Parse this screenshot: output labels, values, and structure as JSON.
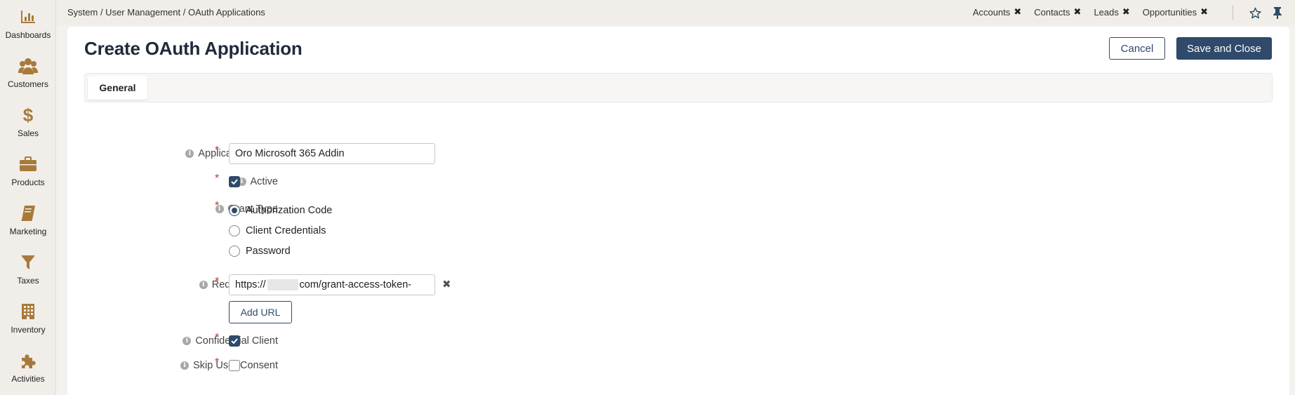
{
  "sidebar": {
    "items": [
      {
        "label": "Dashboards",
        "icon": "bar-chart-icon"
      },
      {
        "label": "Customers",
        "icon": "users-icon"
      },
      {
        "label": "Sales",
        "icon": "dollar-icon"
      },
      {
        "label": "Products",
        "icon": "briefcase-icon"
      },
      {
        "label": "Marketing",
        "icon": "book-icon"
      },
      {
        "label": "Taxes",
        "icon": "filter-icon"
      },
      {
        "label": "Inventory",
        "icon": "building-icon"
      },
      {
        "label": "Activities",
        "icon": "puzzle-icon"
      }
    ],
    "icon_color": "#a77a3b"
  },
  "topbar": {
    "breadcrumb": "System / User Management / OAuth Applications",
    "pinned_tabs": [
      "Accounts",
      "Contacts",
      "Leads",
      "Opportunities"
    ],
    "close_glyph": "✖",
    "favorite_icon": "star-outline-icon",
    "pin_icon": "pin-icon"
  },
  "page": {
    "title": "Create OAuth Application",
    "cancel_label": "Cancel",
    "save_label": "Save and Close",
    "tabs": [
      {
        "label": "General",
        "active": true
      }
    ]
  },
  "form": {
    "required_mark": "*",
    "info_glyph": "i",
    "application_name": {
      "label": "Application Name",
      "value": "Oro Microsoft 365 Addin"
    },
    "active": {
      "label": "Active",
      "checked": true
    },
    "grant_type": {
      "label": "Grant Type",
      "options": [
        {
          "label": "Authorization Code",
          "selected": true
        },
        {
          "label": "Client Credentials",
          "selected": false
        },
        {
          "label": "Password",
          "selected": false
        }
      ]
    },
    "redirect_urls": {
      "label": "Redirect URLs",
      "value_prefix": "https://",
      "value_suffix": "com/grant-access-token-",
      "add_label": "Add URL"
    },
    "confidential_client": {
      "label": "Confidential Client",
      "checked": true
    },
    "skip_user_consent": {
      "label": "Skip User Consent",
      "checked": false
    }
  },
  "colors": {
    "primary": "#2f4a6a",
    "required": "#c0392b",
    "sidebar_bg": "#f1eee9"
  }
}
